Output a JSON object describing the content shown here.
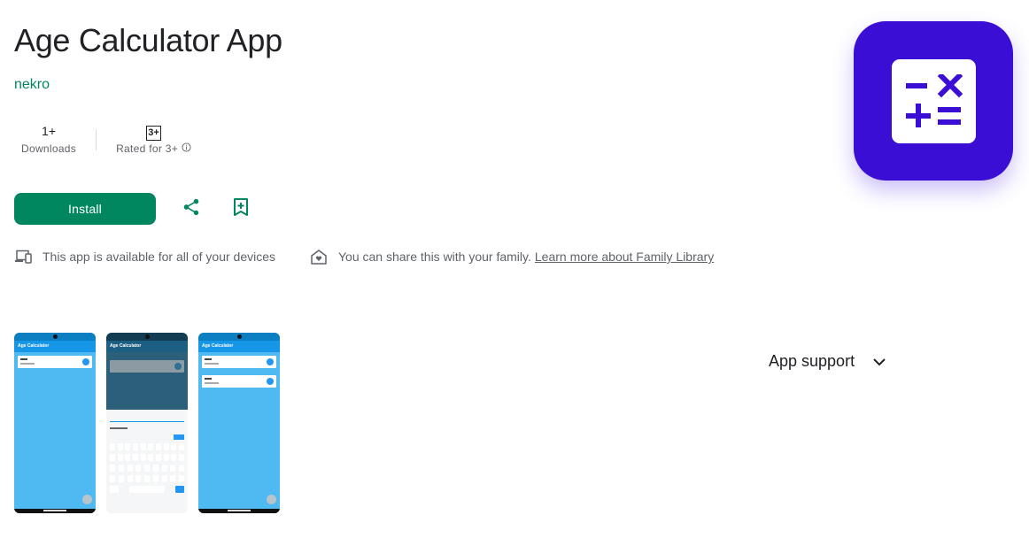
{
  "app": {
    "title": "Age Calculator App",
    "developer": "nekro",
    "icon_name": "calculator-icon",
    "icon_bg": "#3b0ed6"
  },
  "stats": {
    "downloads_value": "1+",
    "downloads_label": "Downloads",
    "rating_badge": "3+",
    "rating_label": "Rated for 3+"
  },
  "actions": {
    "install_label": "Install",
    "share_icon": "share-icon",
    "wishlist_icon": "bookmark-add-icon",
    "accent": "#01875f"
  },
  "availability": {
    "devices_text": "This app is available for all of your devices",
    "family_text": "You can share this with your family.",
    "family_link": "Learn more about Family Library"
  },
  "screenshots": {
    "app_bar_title": "Age Calculator"
  },
  "support": {
    "label": "App support"
  }
}
